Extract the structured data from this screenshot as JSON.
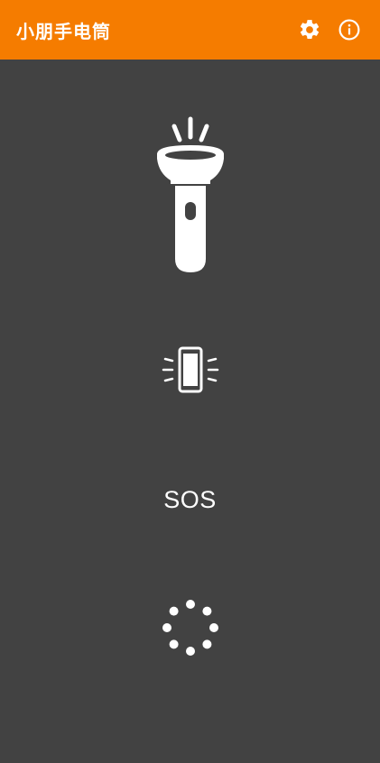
{
  "app": {
    "title": "小朋手电筒",
    "colors": {
      "appbar": "#F57C00",
      "background": "#424242",
      "foreground": "#FFFFFF"
    }
  },
  "appbar": {
    "actions": [
      {
        "icon": "gear-icon"
      },
      {
        "icon": "info-icon"
      }
    ]
  },
  "modes": {
    "flashlight": {
      "icon": "flashlight-icon"
    },
    "screen_light": {
      "icon": "vibrating-phone-icon"
    },
    "sos": {
      "label": "SOS"
    },
    "strobe": {
      "icon": "dotted-circle-icon"
    }
  }
}
